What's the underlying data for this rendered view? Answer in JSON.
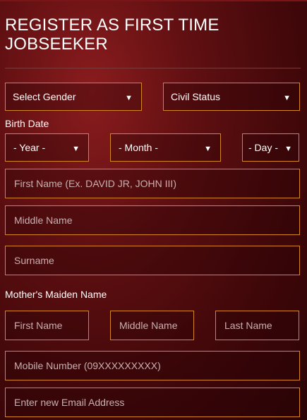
{
  "title": "REGISTER AS FIRST TIME JOBSEEKER",
  "gender": {
    "placeholder": "Select Gender"
  },
  "civil_status": {
    "placeholder": "Civil Status"
  },
  "birth_date": {
    "label": "Birth Date",
    "year": "- Year -",
    "month": "- Month -",
    "day": "- Day -"
  },
  "first_name": {
    "placeholder": "First Name (Ex. DAVID JR, JOHN III)"
  },
  "middle_name": {
    "placeholder": "Middle Name"
  },
  "surname": {
    "placeholder": "Surname"
  },
  "mothers_maiden": {
    "label": "Mother's Maiden Name",
    "first": "First Name",
    "middle": "Middle Name",
    "last": "Last Name"
  },
  "mobile": {
    "placeholder": "Mobile Number (09XXXXXXXXX)"
  },
  "email": {
    "placeholder": "Enter new Email Address"
  },
  "icons": {
    "dropdown": "chevron-down-icon"
  },
  "colors": {
    "accent_border": "#d6861f",
    "background": "#5e0f11"
  }
}
